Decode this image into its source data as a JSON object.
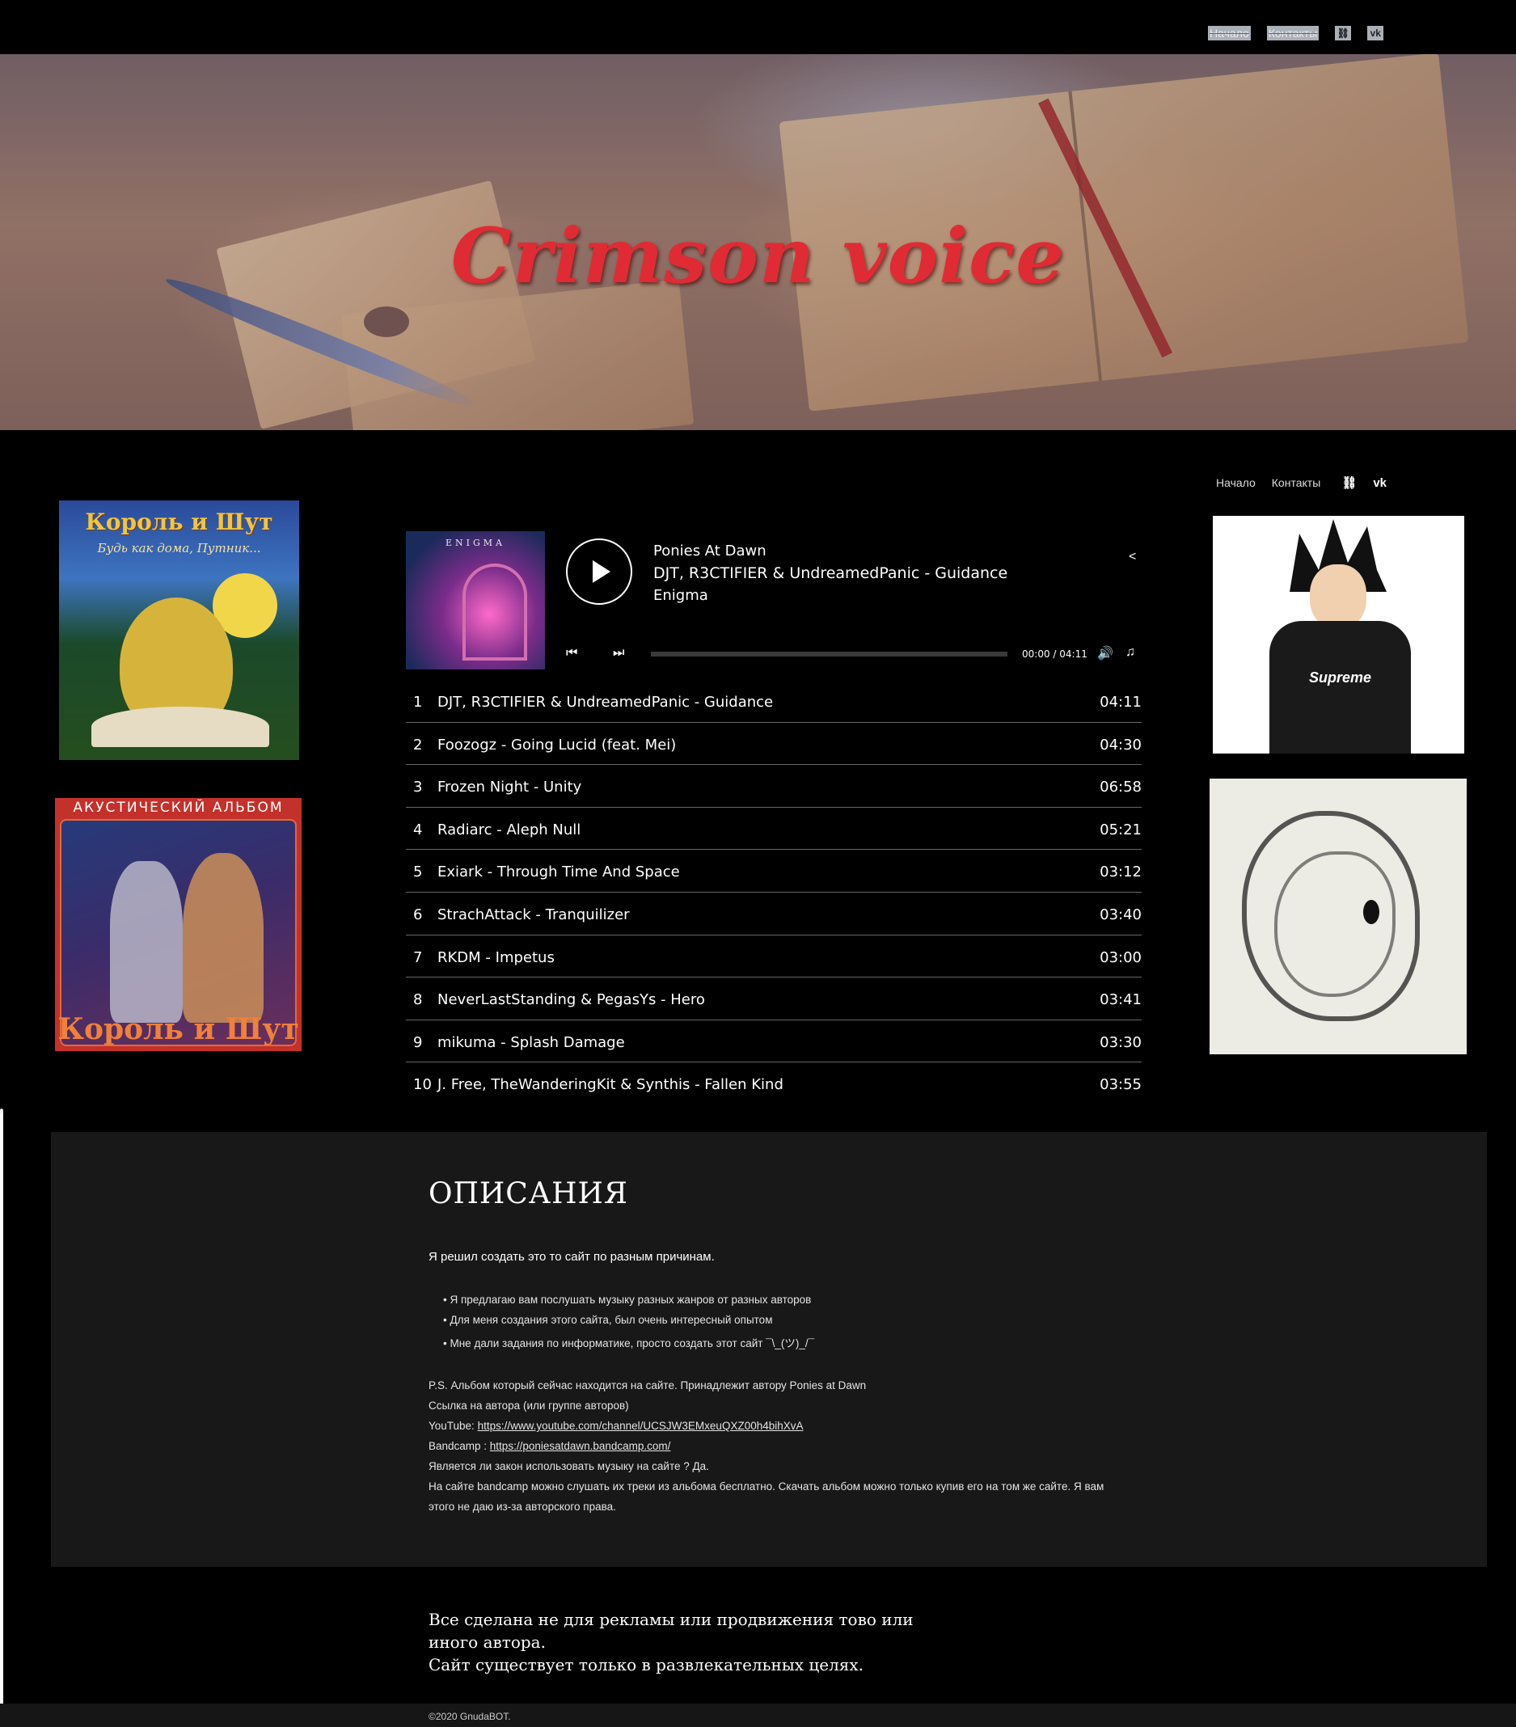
{
  "topnav": {
    "home": "Начало",
    "contacts": "Контакты",
    "link_icon": "link-icon",
    "vk_icon": "vk-icon"
  },
  "hero": {
    "title": "Crimson voice"
  },
  "subnav": {
    "home": "Начало",
    "contacts": "Контакты",
    "link_icon": "link-icon",
    "vk_icon": "vk-icon"
  },
  "covers": {
    "cover1_title": "Король и Шут",
    "cover1_subtitle": "Будь как дома, Путник...",
    "cover2_top": "АКУСТИЧЕСКИЙ АЛЬБОМ",
    "cover2_bottom": "Король и Шут",
    "cover3_brand": "Supreme"
  },
  "player": {
    "art_label": "ENIGMA",
    "artist": "Ponies At Dawn",
    "current_track": "DJT, R3CTIFIER & UndreamedPanic - Guidance",
    "album": "Enigma",
    "time": "00:00 / 04:11",
    "progress": 0,
    "icons": {
      "play": "play-icon",
      "prev": "previous-icon",
      "next": "next-icon",
      "share": "share-icon",
      "volume": "volume-icon",
      "playlist": "playlist-icon"
    }
  },
  "tracks": [
    {
      "num": "1",
      "title": "DJT, R3CTIFIER & UndreamedPanic - Guidance",
      "duration": "04:11"
    },
    {
      "num": "2",
      "title": "Foozogz - Going Lucid (feat. Mei)",
      "duration": "04:30"
    },
    {
      "num": "3",
      "title": "Frozen Night - Unity",
      "duration": "06:58"
    },
    {
      "num": "4",
      "title": "Radiarc - Aleph Null",
      "duration": "05:21"
    },
    {
      "num": "5",
      "title": "Exiark - Through Time And Space",
      "duration": "03:12"
    },
    {
      "num": "6",
      "title": "StrachAttack - Tranquilizer",
      "duration": "03:40"
    },
    {
      "num": "7",
      "title": "RKDM - Impetus",
      "duration": "03:00"
    },
    {
      "num": "8",
      "title": "NeverLastStanding & PegasYs - Hero",
      "duration": "03:41"
    },
    {
      "num": "9",
      "title": "mikuma - Splash Damage",
      "duration": "03:30"
    },
    {
      "num": "10",
      "title": "J. Free, TheWanderingKit & Synthis - Fallen Kind",
      "duration": "03:55"
    }
  ],
  "description": {
    "heading": "ОПИСАНИЯ",
    "intro": "Я решил создать это то сайт по разным причинам.",
    "bullets": [
      "Я предлагаю  вам послушать музыку разных жанров от разных авторов",
      "Для меня создания этого сайта, был очень интересный опытом",
      "Мне дали задания по информатике, просто создать этот сайт  ¯\\_(ツ)_/¯"
    ],
    "ps_line": "P.S. Альбом который сейчас находится на сайте. Принадлежит автору Ponies at Dawn",
    "author_link_line": "Ссылка на автора (или группе авторов)",
    "youtube_label": "YouTube: ",
    "youtube_url": "https://www.youtube.com/channel/UCSJW3EMxeuQXZ00h4bihXvA",
    "bandcamp_label": "Bandcamp : ",
    "bandcamp_url": "https://poniesatdawn.bandcamp.com/",
    "legal_q": "Является ли закон  использовать музыку на сайте ? Да.",
    "legal_a": "На сайте bandcamp можно слушать их треки из альбома  бесплатно. Скачать альбом можно только купив его на том же сайте. Я вам этого не даю из-за авторского права."
  },
  "closing": {
    "line1": "Все сделана не для рекламы или продвижения тово или иного автора.",
    "line2": "Сайт существует только в развлекательных целях."
  },
  "footer": {
    "copyright": "©2020 GnudaBOT."
  }
}
